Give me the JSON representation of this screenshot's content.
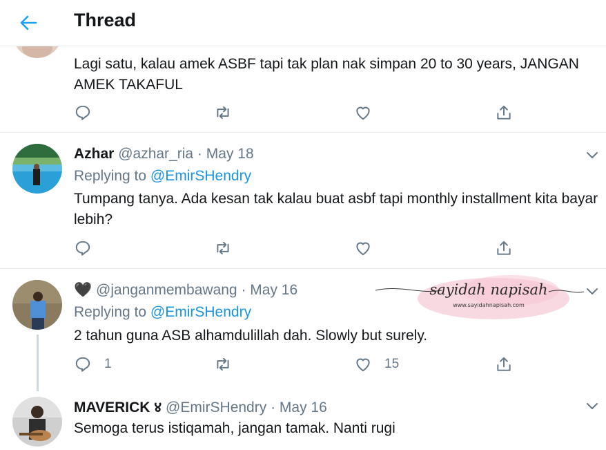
{
  "header": {
    "title": "Thread"
  },
  "tweets": [
    {
      "text": "Lagi satu, kalau amek ASBF tapi tak plan nak simpan 20 to 30 years, JANGAN AMEK TAKAFUL"
    },
    {
      "name": "Azhar",
      "handle": "@azhar_ria",
      "sep": "·",
      "date": "May 18",
      "replying_prefix": "Replying to",
      "replying_to": "@EmirSHendry",
      "text": "Tumpang tanya. Ada kesan tak kalau buat asbf tapi monthly installment kita bayar lebih?"
    },
    {
      "name": "🖤",
      "handle": "@janganmembawang",
      "sep": "·",
      "date": "May 16",
      "replying_prefix": "Replying to",
      "replying_to": "@EmirSHendry",
      "text": "2 tahun guna ASB alhamdulillah dah. Slowly but surely.",
      "reply_count": "1",
      "like_count": "15"
    },
    {
      "name": "MAVERICK ४",
      "handle": "@EmirSHendry",
      "sep": "·",
      "date": "May 16",
      "text": "Semoga terus istiqamah, jangan tamak. Nanti rugi"
    }
  ],
  "watermark": {
    "title": "sayidah napisah",
    "url": "www.sayidahnapisah.com"
  },
  "colors": {
    "accent": "#1da1f2",
    "icon": "#657786",
    "text": "#14171a",
    "divider": "#e6ecf0"
  }
}
